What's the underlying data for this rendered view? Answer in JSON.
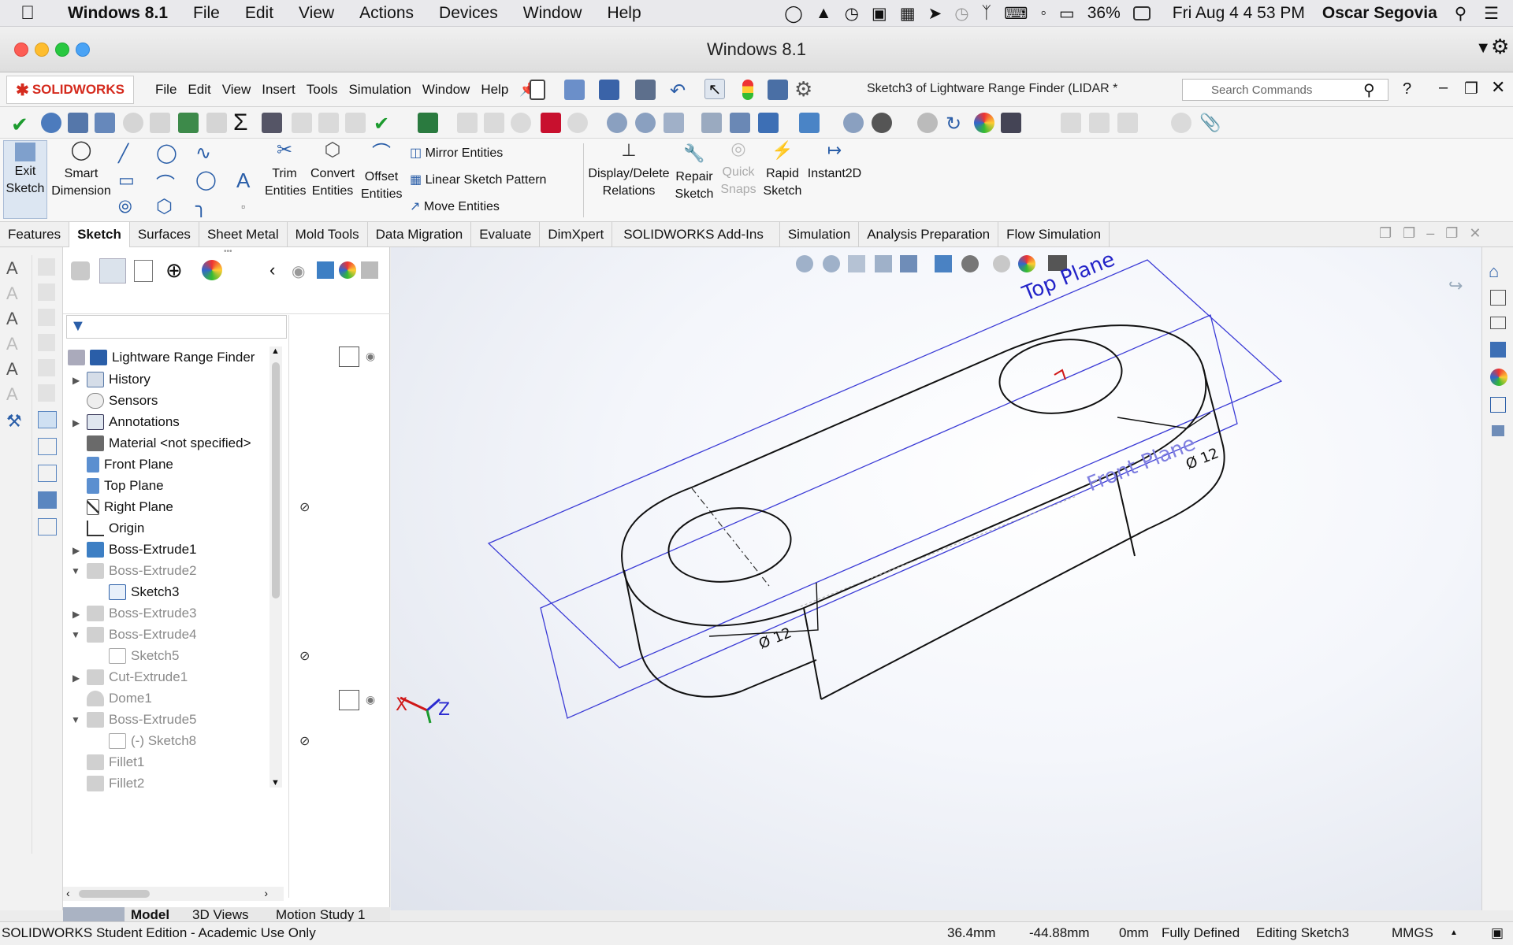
{
  "mac_menubar": {
    "app": "Windows 8.1",
    "items": [
      "File",
      "Edit",
      "View",
      "Actions",
      "Devices",
      "Window",
      "Help"
    ],
    "battery": "36%",
    "datetime": "Fri Aug 4  4 53 PM",
    "user": "Oscar Segovia"
  },
  "window": {
    "title": "Windows 8.1"
  },
  "solidworks": {
    "logo": "SOLIDWORKS",
    "menu": [
      "File",
      "Edit",
      "View",
      "Insert",
      "Tools",
      "Simulation",
      "Window",
      "Help"
    ],
    "document_title": "Sketch3 of Lightware Range Finder (LIDAR *",
    "search_placeholder": "Search Commands"
  },
  "command_manager": {
    "exit_sketch": [
      "Exit",
      "Sketch"
    ],
    "smart_dimension": [
      "Smart",
      "Dimension"
    ],
    "trim_entities": [
      "Trim",
      "Entities"
    ],
    "convert_entities": [
      "Convert",
      "Entities"
    ],
    "offset_entities": [
      "Offset",
      "Entities"
    ],
    "mirror_entities": "Mirror Entities",
    "linear_sketch_pattern": "Linear Sketch Pattern",
    "move_entities": "Move Entities",
    "display_delete_relations": [
      "Display/Delete",
      "Relations"
    ],
    "repair_sketch": [
      "Repair",
      "Sketch"
    ],
    "quick_snaps": [
      "Quick",
      "Snaps"
    ],
    "rapid_sketch": [
      "Rapid",
      "Sketch"
    ],
    "instant2d": "Instant2D"
  },
  "tabs": [
    "Features",
    "Sketch",
    "Surfaces",
    "Sheet Metal",
    "Mold Tools",
    "Data Migration",
    "Evaluate",
    "DimXpert",
    "SOLIDWORKS Add-Ins",
    "Simulation",
    "Analysis Preparation",
    "Flow Simulation"
  ],
  "active_tab": "Sketch",
  "feature_tree": [
    {
      "label": "Lightware Range Finder",
      "grey": false
    },
    {
      "label": "History",
      "grey": false
    },
    {
      "label": "Sensors",
      "grey": false
    },
    {
      "label": "Annotations",
      "grey": false
    },
    {
      "label": "Material <not specified>",
      "grey": false
    },
    {
      "label": "Front Plane",
      "grey": false
    },
    {
      "label": "Top Plane",
      "grey": false
    },
    {
      "label": "Right Plane",
      "grey": false
    },
    {
      "label": "Origin",
      "grey": false
    },
    {
      "label": "Boss-Extrude1",
      "grey": false
    },
    {
      "label": "Boss-Extrude2",
      "grey": true
    },
    {
      "label": "Sketch3",
      "grey": false
    },
    {
      "label": "Boss-Extrude3",
      "grey": true
    },
    {
      "label": "Boss-Extrude4",
      "grey": true
    },
    {
      "label": "Sketch5",
      "grey": true
    },
    {
      "label": "Cut-Extrude1",
      "grey": true
    },
    {
      "label": "Dome1",
      "grey": true
    },
    {
      "label": "Boss-Extrude5",
      "grey": true
    },
    {
      "label": "(-) Sketch8",
      "grey": true
    },
    {
      "label": "Fillet1",
      "grey": true
    },
    {
      "label": "Fillet2",
      "grey": true
    }
  ],
  "bottom_tabs": [
    "Model",
    "3D Views",
    "Motion Study 1"
  ],
  "viewport": {
    "top_plane_label": "Top Plane",
    "front_plane_label": "Front Plane",
    "dim_label_1": "Ø 12",
    "dim_label_2": "Ø 12",
    "axis_x": "X",
    "axis_z": "Z"
  },
  "status": {
    "edition": "SOLIDWORKS Student Edition - Academic Use Only",
    "x": "36.4mm",
    "y": "-44.88mm",
    "z": "0mm",
    "defined": "Fully Defined",
    "editing": "Editing Sketch3",
    "units": "MMGS"
  }
}
